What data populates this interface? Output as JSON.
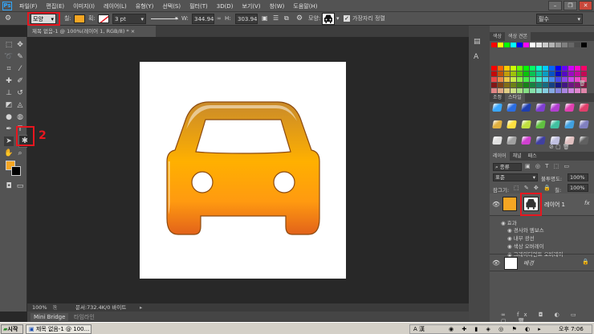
{
  "app": {
    "logo": "Ps"
  },
  "menu": [
    "파일(F)",
    "편집(E)",
    "이미지(I)",
    "레이어(L)",
    "유형(Y)",
    "선택(S)",
    "필터(T)",
    "3D(D)",
    "보기(V)",
    "창(W)",
    "도움말(H)"
  ],
  "options_bar": {
    "mode_label": "모양",
    "fill_label": "칠:",
    "stroke_label": "획:",
    "stroke_width": "3 pt",
    "w_label": "W:",
    "w_value": "344.94",
    "h_label": "H:",
    "h_value": "303.94",
    "shape_label": "모양:",
    "align_edges_label": "가장자리 정렬",
    "workspace": "필수",
    "fill_color": "#f5a623"
  },
  "document": {
    "tab_title": "제목 없음-1 @ 100%(레이어 1, RGB/8) *",
    "zoom": "100%",
    "doc_info": "문서:732.4K/0 바이트"
  },
  "annotation": {
    "label": "2"
  },
  "bottom_tabs": [
    "Mini Bridge",
    "타임라인"
  ],
  "panels": {
    "color_tabs": [
      "색상",
      "색상 견본"
    ],
    "style_tabs": [
      "조정",
      "스타일"
    ],
    "layer_tabs": [
      "레이어",
      "채널",
      "패스"
    ],
    "kind_label": "종류",
    "blend_mode": "표준",
    "opacity_label": "불투명도:",
    "opacity_value": "100%",
    "lock_label": "잠그기:",
    "fill_label": "칠:",
    "fill_value": "100%",
    "layer1_name": "레이어 1",
    "fx_label": "fx",
    "effects_label": "효과",
    "effects": [
      "경사와 엠보스",
      "내부 광선",
      "색상 오버레이",
      "그레이디언트 오버레이"
    ],
    "background_layer": "배경"
  },
  "taskbar": {
    "start": "시작",
    "task_item": "제목 없음-1 @ 100...",
    "lang": "A 漢",
    "clock": "오후 7:06"
  }
}
